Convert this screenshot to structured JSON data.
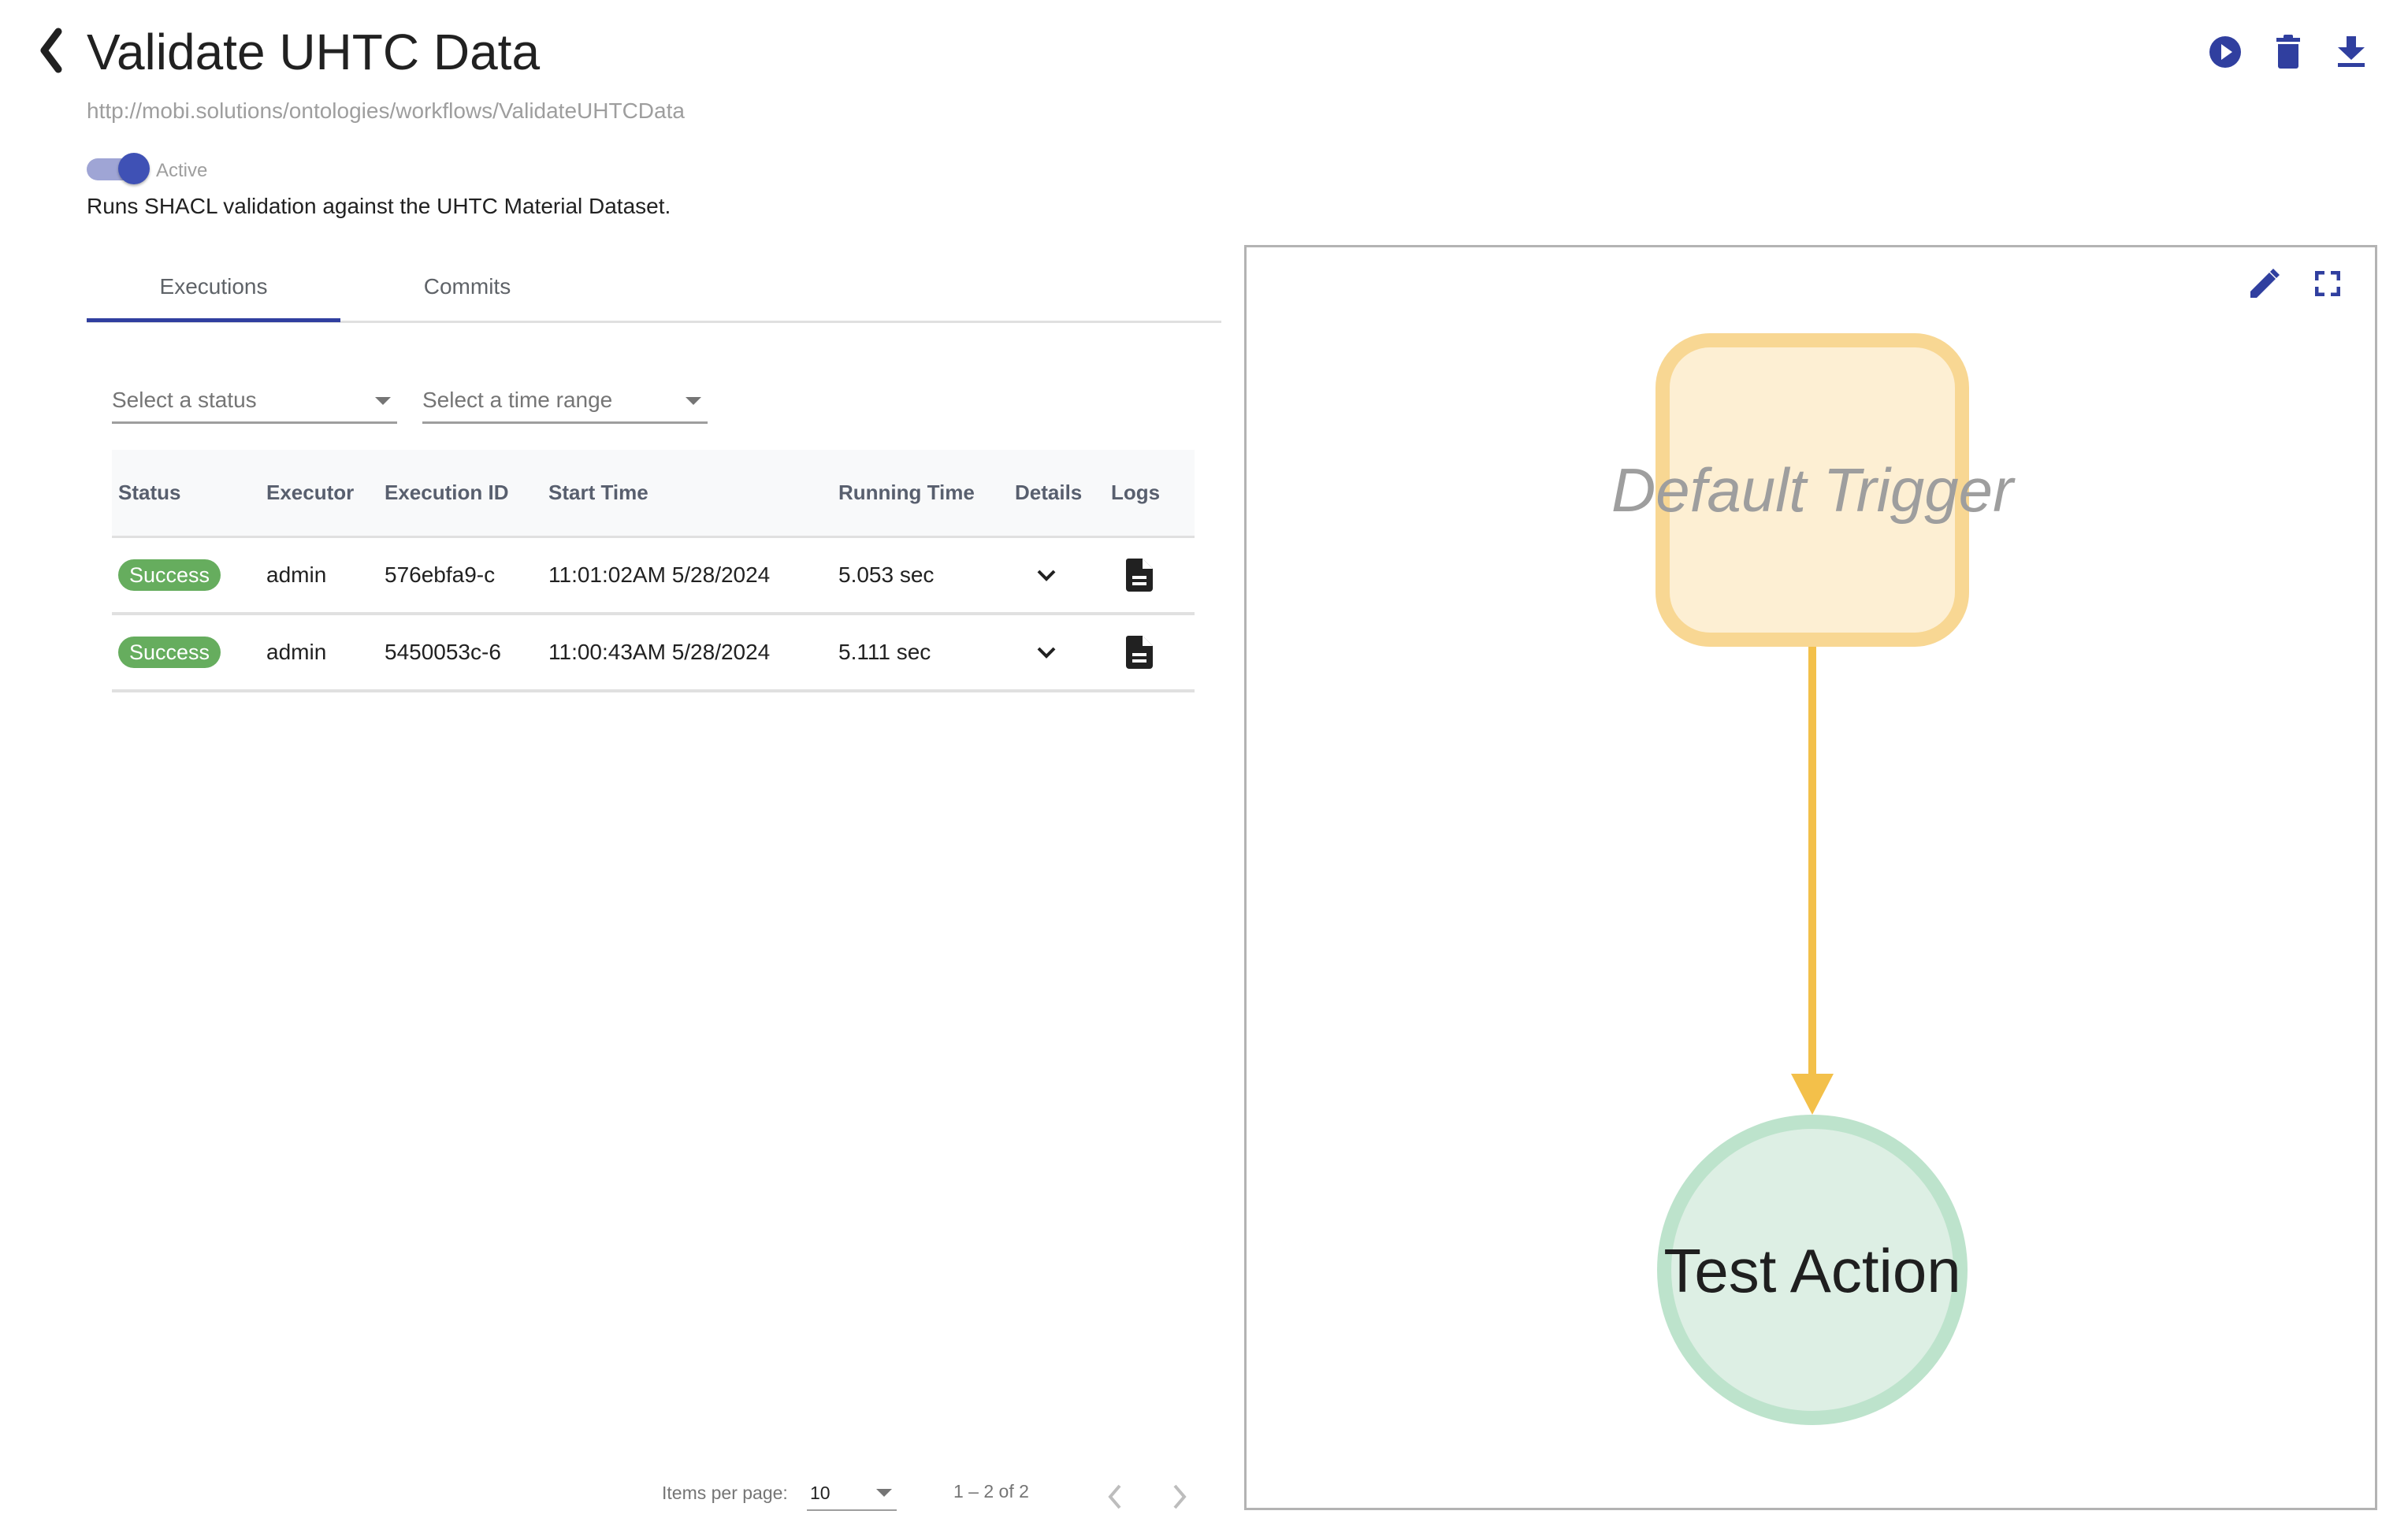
{
  "header": {
    "title": "Validate UHTC Data",
    "iri": "http://mobi.solutions/ontologies/workflows/ValidateUHTCData",
    "actions": [
      {
        "name": "run",
        "icon": "play-circle-icon"
      },
      {
        "name": "delete",
        "icon": "trash-icon"
      },
      {
        "name": "download",
        "icon": "download-icon"
      }
    ]
  },
  "status": {
    "active_label": "Active",
    "active": true,
    "description": "Runs SHACL validation against the UHTC Material Dataset."
  },
  "tabs": [
    {
      "label": "Executions",
      "selected": true
    },
    {
      "label": "Commits",
      "selected": false
    }
  ],
  "filters": {
    "status_placeholder": "Select a status",
    "time_placeholder": "Select a time range"
  },
  "table": {
    "columns": [
      "Status",
      "Executor",
      "Execution ID",
      "Start Time",
      "Running Time",
      "Details",
      "Logs"
    ],
    "rows": [
      {
        "status": "Success",
        "executor": "admin",
        "execution_id": "576ebfa9-c",
        "start_time": "11:01:02AM 5/28/2024",
        "running_time": "5.053 sec"
      },
      {
        "status": "Success",
        "executor": "admin",
        "execution_id": "5450053c-6",
        "start_time": "11:00:43AM 5/28/2024",
        "running_time": "5.111 sec"
      }
    ]
  },
  "paginator": {
    "items_per_page_label": "Items per page:",
    "items_per_page": "10",
    "range_label": "1 – 2 of 2"
  },
  "graph": {
    "nodes": [
      {
        "id": "trigger",
        "label": "Default Trigger",
        "shape": "rounded-square",
        "fill": "#fdefd3",
        "stroke": "#f8d793",
        "text_color": "#9e9e9e"
      },
      {
        "id": "action",
        "label": "Test Action",
        "shape": "circle",
        "fill": "#ddefe4",
        "stroke": "#bde3cc",
        "text_color": "#1f1f1f"
      }
    ],
    "edges": [
      {
        "from": "trigger",
        "to": "action",
        "color": "#f3c04a"
      }
    ]
  },
  "colors": {
    "primary": "#303f9f",
    "success": "#66ad5e"
  }
}
